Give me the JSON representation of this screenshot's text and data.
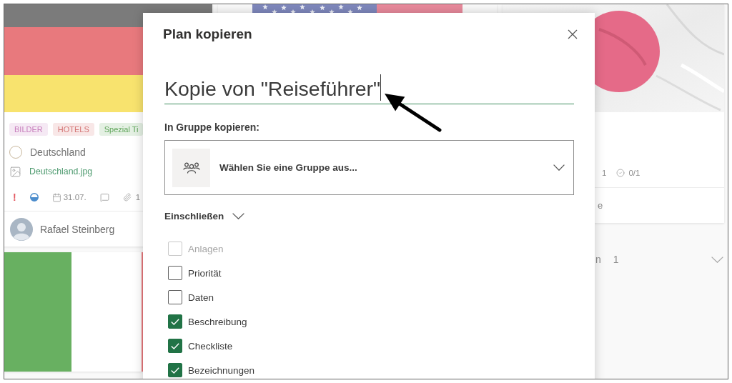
{
  "board": {
    "columns": [
      {
        "cards": [
          {
            "cover": {
              "kind": "germany"
            },
            "labels": [
              {
                "text": "BILDER",
                "color": "#c77cbc"
              },
              {
                "text": "HOTELS",
                "color": "#d47474"
              },
              {
                "text": "Spezial Ti",
                "color": "#5fa55a"
              }
            ],
            "task": {
              "title": "Deutschland",
              "completed": false
            },
            "attachment": {
              "name": "Deutschland.jpg"
            },
            "footer": [
              {
                "kind": "priority",
                "text": "!"
              },
              {
                "kind": "progress",
                "in_progress": true
              },
              {
                "kind": "due",
                "text": "31.07."
              },
              {
                "kind": "comments"
              },
              {
                "kind": "attachments",
                "text": "1"
              }
            ],
            "assignee": {
              "name": "Rafael Steinberg"
            }
          },
          {
            "cover": {
              "kind": "italy"
            }
          }
        ]
      },
      {
        "cards": [
          {
            "cover": {
              "kind": "usa"
            }
          }
        ]
      },
      {
        "cards": [
          {
            "cover": {
              "kind": "japan"
            },
            "footer": [
              {
                "kind": "count",
                "text": "1"
              },
              {
                "kind": "checklist",
                "text": "0/1",
                "completed": false
              }
            ],
            "line_text": "e"
          }
        ],
        "section": {
          "label": "n",
          "count": "1"
        }
      }
    ]
  },
  "dialog": {
    "title": "Plan kopieren",
    "name_field": {
      "value": "Kopie von \"Reiseführer\""
    },
    "group_label": "In Gruppe kopieren:",
    "group_select": {
      "placeholder": "Wählen Sie eine Gruppe aus..."
    },
    "include": {
      "label": "Einschließen",
      "options": [
        {
          "label": "Anlagen",
          "checked": false,
          "disabled": true
        },
        {
          "label": "Priorität",
          "checked": false,
          "disabled": false
        },
        {
          "label": "Daten",
          "checked": false,
          "disabled": false
        },
        {
          "label": "Beschreibung",
          "checked": true,
          "disabled": false
        },
        {
          "label": "Checkliste",
          "checked": true,
          "disabled": false
        },
        {
          "label": "Bezeichnungen",
          "checked": true,
          "disabled": false
        }
      ]
    }
  }
}
